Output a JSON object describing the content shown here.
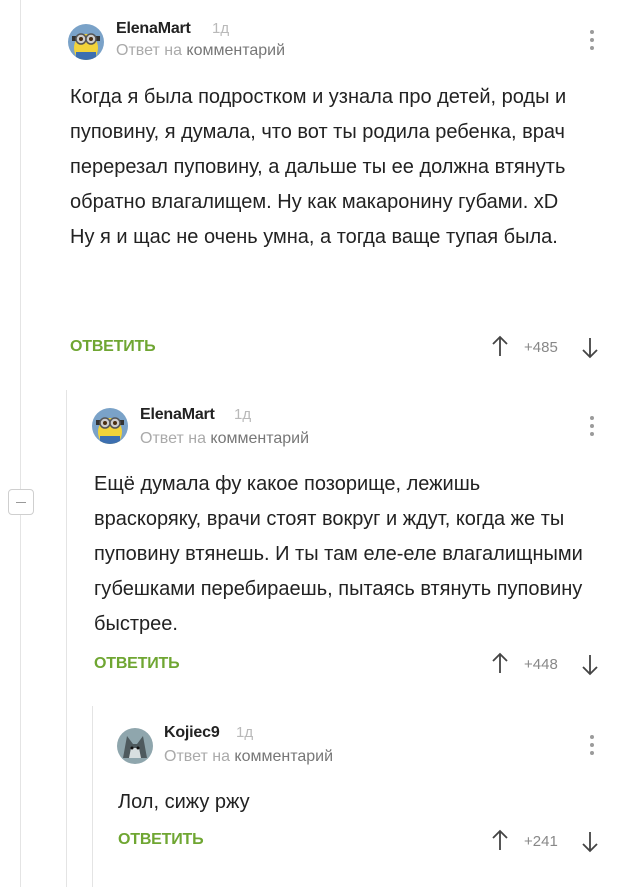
{
  "comments": [
    {
      "author": "ElenaMart",
      "age": "1д",
      "meta_prefix": "Ответ на",
      "meta_link": "комментарий",
      "text": "Когда я была подростком и узнала про детей, роды и пуповину, я думала, что вот ты родила ребенка, врач перерезал пуповину, а дальше ты ее должна втянуть обратно влагалищем. Ну как макаронину губами. xD\nНу я и щас не очень умна, а тогда ваще тупая была.",
      "reply_label": "ОТВЕТИТЬ",
      "score": "+485"
    },
    {
      "author": "ElenaMart",
      "age": "1д",
      "meta_prefix": "Ответ на",
      "meta_link": "комментарий",
      "text": "Ещё думала фу какое позорище, лежишь враскоряку, врачи стоят вокруг и ждут, когда же ты пуповину втянешь. И ты там еле-еле влагалищными губешками перебираешь, пытаясь втянуть пуповину быстрее.",
      "reply_label": "ОТВЕТИТЬ",
      "score": "+448"
    },
    {
      "author": "Kojiec9",
      "age": "1д",
      "meta_prefix": "Ответ на",
      "meta_link": "комментарий",
      "text": "Лол, сижу ржу",
      "reply_label": "ОТВЕТИТЬ",
      "score": "+241"
    }
  ],
  "colors": {
    "reply": "#6fa632",
    "thread_line": "#e4e4e4",
    "muted": "#aaaaaa"
  },
  "icons": [
    "minion-avatar",
    "wolf-avatar",
    "kebab-menu-icon",
    "arrow-up-icon",
    "arrow-down-icon",
    "collapse-minus-icon"
  ]
}
